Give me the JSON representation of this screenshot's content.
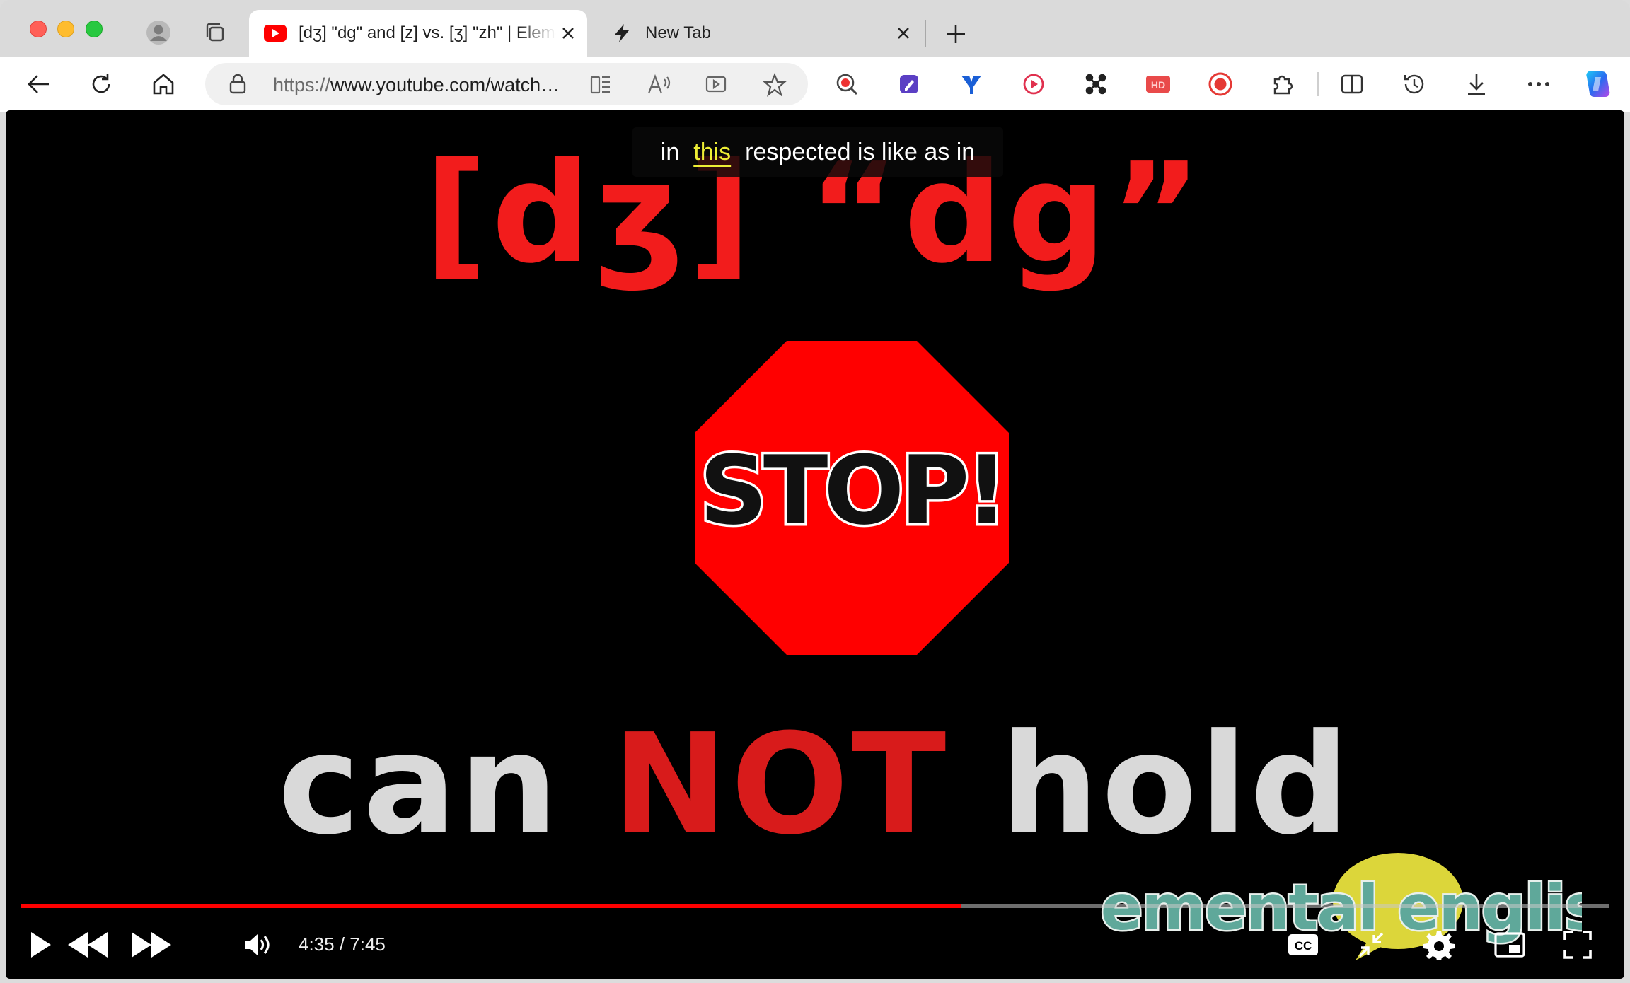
{
  "browser": {
    "tabs": [
      {
        "title": "[dʒ] \"dg\" and [z] vs. [ʒ] \"zh\" | Elemental English",
        "favicon": "youtube-icon",
        "active": true
      },
      {
        "title": "New Tab",
        "favicon": "lightning-icon",
        "active": false
      }
    ],
    "address_bar": {
      "url_scheme": "https://",
      "url_rest": "www.youtube.com/watch?v="
    },
    "toolbar_icons": [
      "back-icon",
      "refresh-icon",
      "home-icon",
      "lock-icon",
      "split-screen-icon",
      "read-aloud-icon",
      "video-translate-icon",
      "favorite-star-icon",
      "extension-search-icon",
      "extension-note-icon",
      "extension-y-icon",
      "extension-play-icon",
      "extension-nodes-icon",
      "extension-hd-icon",
      "extension-record-icon",
      "extensions-puzzle-icon",
      "split-view-icon",
      "history-icon",
      "downloads-icon",
      "more-icon",
      "copilot-icon"
    ]
  },
  "video": {
    "caption": {
      "before": "in",
      "highlight": "this",
      "after": "respected is like as in"
    },
    "frame": {
      "title_ipa": "[dʒ] “dg”",
      "stop_sign_text": "STOP!",
      "bottom_word_1": "can",
      "bottom_word_2": "NOT",
      "bottom_word_3": "hold",
      "logo_text": "elemental english"
    },
    "player": {
      "time": "4:35 / 7:45",
      "progress": 0.592
    }
  },
  "colors": {
    "accent_red": "#ff0000",
    "title_red": "#f21c1c",
    "caption_highlight": "#eded35"
  }
}
